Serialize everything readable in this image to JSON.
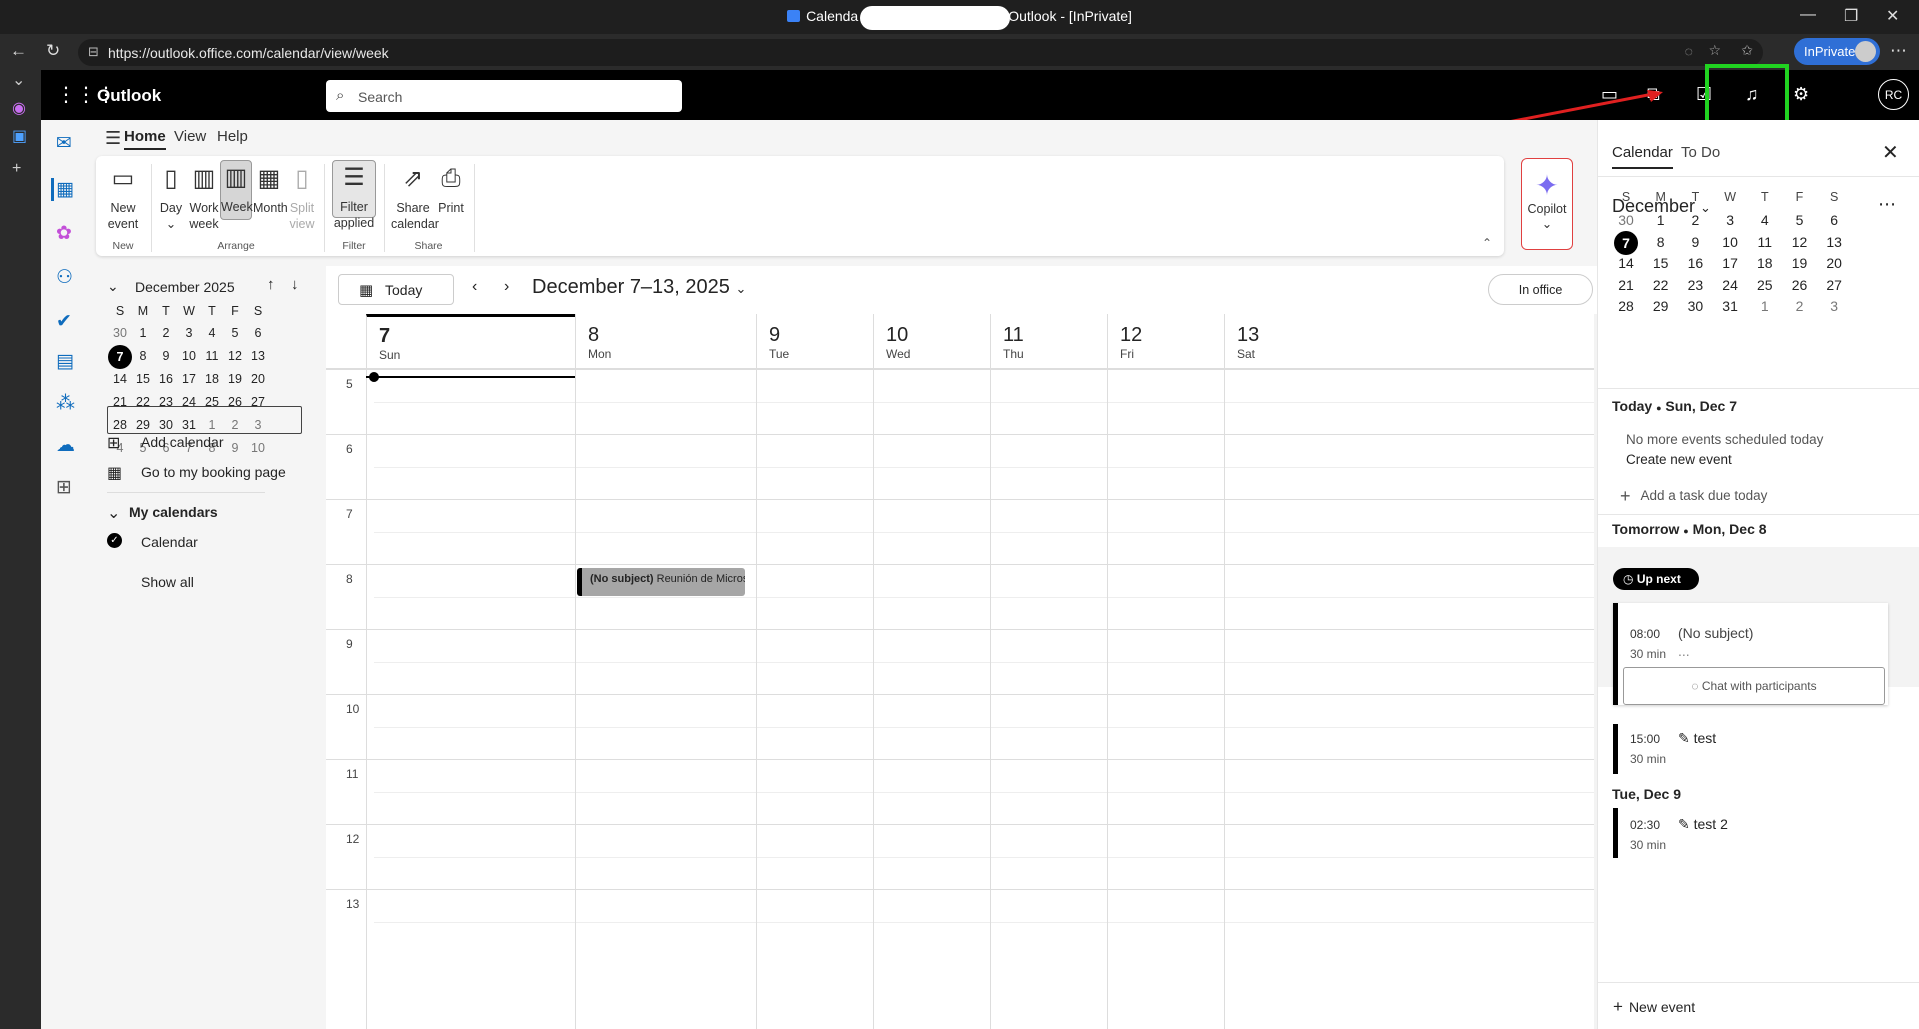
{
  "browser": {
    "title_left": "Calenda",
    "title_right": "Outlook - [InPrivate]",
    "url": "https://outlook.office.com/calendar/view/week",
    "inprivate_label": "InPrivate",
    "controls": [
      "—",
      "❐",
      "✕"
    ]
  },
  "app": {
    "name": "Outlook",
    "search_placeholder": "Search",
    "avatar_initials": "RC"
  },
  "ribbon": {
    "tabs": [
      "Home",
      "View",
      "Help"
    ],
    "buttons": {
      "new_event": "New\nevent",
      "day": "Day",
      "work_week": "Work\nweek",
      "week": "Week",
      "month": "Month",
      "split_view": "Split\nview",
      "filter_applied": "Filter\napplied",
      "share_calendar": "Share\ncalendar",
      "print": "Print",
      "copilot": "Copilot"
    },
    "groups": [
      "New",
      "Arrange",
      "Filter",
      "Share"
    ]
  },
  "minical": {
    "title": "December 2025",
    "weekdays": [
      "S",
      "M",
      "T",
      "W",
      "T",
      "F",
      "S"
    ],
    "weeks": [
      [
        "30",
        "1",
        "2",
        "3",
        "4",
        "5",
        "6"
      ],
      [
        "7",
        "8",
        "9",
        "10",
        "11",
        "12",
        "13"
      ],
      [
        "14",
        "15",
        "16",
        "17",
        "18",
        "19",
        "20"
      ],
      [
        "21",
        "22",
        "23",
        "24",
        "25",
        "26",
        "27"
      ],
      [
        "28",
        "29",
        "30",
        "31",
        "1",
        "2",
        "3"
      ],
      [
        "4",
        "5",
        "6",
        "7",
        "8",
        "9",
        "10"
      ]
    ],
    "selected": "7"
  },
  "leftnav": {
    "add_calendar": "Add calendar",
    "booking_page": "Go to my booking page",
    "my_calendars": "My calendars",
    "calendar": "Calendar",
    "show_all": "Show all"
  },
  "calendar": {
    "today_button": "Today",
    "range": "December 7–13, 2025",
    "in_office": "In office",
    "days": [
      {
        "num": "7",
        "name": "Sun"
      },
      {
        "num": "8",
        "name": "Mon"
      },
      {
        "num": "9",
        "name": "Tue"
      },
      {
        "num": "10",
        "name": "Wed"
      },
      {
        "num": "11",
        "name": "Thu"
      },
      {
        "num": "12",
        "name": "Fri"
      },
      {
        "num": "13",
        "name": "Sat"
      }
    ],
    "hours": [
      "5",
      "6",
      "7",
      "8",
      "9",
      "10",
      "11",
      "12",
      "13"
    ],
    "event": {
      "subject": "(No subject)",
      "detail": "Reunión de Microsoft T"
    }
  },
  "rightpane": {
    "tab_calendar": "Calendar",
    "tab_todo": "To Do",
    "month": "December",
    "weekdays": [
      "S",
      "M",
      "T",
      "W",
      "T",
      "F",
      "S"
    ],
    "weeks": [
      [
        "30",
        "1",
        "2",
        "3",
        "4",
        "5",
        "6"
      ],
      [
        "7",
        "8",
        "9",
        "10",
        "11",
        "12",
        "13"
      ],
      [
        "14",
        "15",
        "16",
        "17",
        "18",
        "19",
        "20"
      ],
      [
        "21",
        "22",
        "23",
        "24",
        "25",
        "26",
        "27"
      ],
      [
        "28",
        "29",
        "30",
        "31",
        "1",
        "2",
        "3"
      ]
    ],
    "today_label": "Today",
    "today_date": "Sun, Dec 7",
    "no_events": "No more events scheduled today",
    "create_event": "Create new event",
    "add_task": "Add a task due today",
    "tomorrow_label": "Tomorrow",
    "tomorrow_date": "Mon, Dec 8",
    "up_next": "Up next",
    "events": [
      {
        "time": "08:00",
        "dur": "30 min",
        "title": "(No subject)",
        "extra": "..."
      },
      {
        "time": "15:00",
        "dur": "30 min",
        "title": "test"
      },
      {
        "time": "02:30",
        "dur": "30 min",
        "title": "test 2"
      }
    ],
    "chat_participants": "Chat with participants",
    "tue_label": "Tue, Dec 9",
    "new_event": "New event"
  },
  "accent": {
    "green_highlight": "#21d321",
    "red_arrow": "#e02020",
    "inprivate": "#2f6fd6"
  }
}
